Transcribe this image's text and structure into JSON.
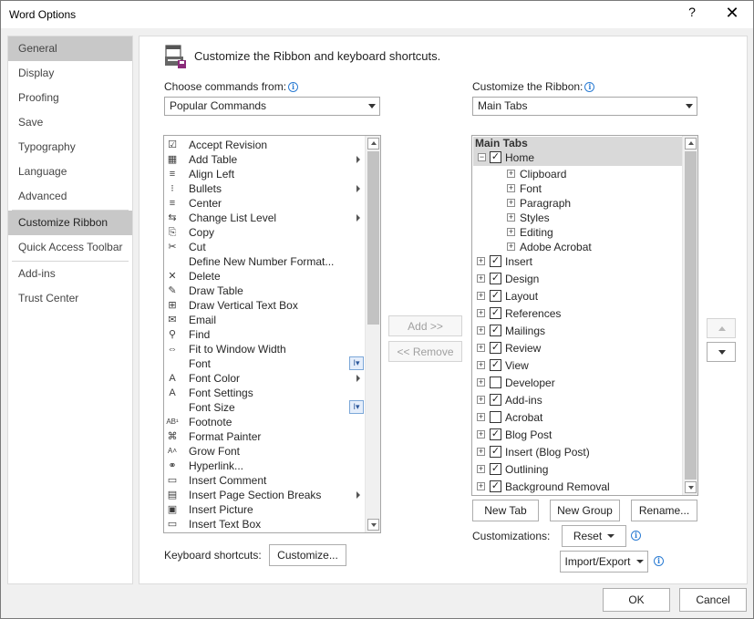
{
  "window": {
    "title": "Word Options",
    "help_glyph": "?",
    "close_glyph": "✕"
  },
  "nav": {
    "items": [
      {
        "label": "General",
        "active": false
      },
      {
        "label": "Display"
      },
      {
        "label": "Proofing"
      },
      {
        "label": "Save"
      },
      {
        "label": "Typography"
      },
      {
        "label": "Language"
      },
      {
        "label": "Advanced"
      },
      {
        "label": "Customize Ribbon"
      },
      {
        "label": "Quick Access Toolbar"
      },
      {
        "label": "Add-ins"
      },
      {
        "label": "Trust Center"
      }
    ]
  },
  "header": {
    "text": "Customize the Ribbon and keyboard shortcuts."
  },
  "left": {
    "choose_label": "Choose commands from:",
    "choose_value": "Popular Commands",
    "commands": [
      {
        "label": "Accept Revision",
        "icon": "☑"
      },
      {
        "label": "Add Table",
        "icon": "▦",
        "submenu": true
      },
      {
        "label": "Align Left",
        "icon": "≡"
      },
      {
        "label": "Bullets",
        "icon": "⁝",
        "submenu": true,
        "bar": true
      },
      {
        "label": "Center",
        "icon": "≡"
      },
      {
        "label": "Change List Level",
        "icon": "⇆",
        "submenu": true
      },
      {
        "label": "Copy",
        "icon": "⎘"
      },
      {
        "label": "Cut",
        "icon": "✂"
      },
      {
        "label": "Define New Number Format...",
        "icon": ""
      },
      {
        "label": "Delete",
        "icon": "✕"
      },
      {
        "label": "Draw Table",
        "icon": "✎"
      },
      {
        "label": "Draw Vertical Text Box",
        "icon": "⊞"
      },
      {
        "label": "Email",
        "icon": "✉"
      },
      {
        "label": "Find",
        "icon": "⚲"
      },
      {
        "label": "Fit to Window Width",
        "icon": "⇔"
      },
      {
        "label": "Font",
        "icon": "",
        "box": "I▾"
      },
      {
        "label": "Font Color",
        "icon": "A",
        "submenu": true
      },
      {
        "label": "Font Settings",
        "icon": "A"
      },
      {
        "label": "Font Size",
        "icon": "",
        "box": "I▾"
      },
      {
        "label": "Footnote",
        "icon": "AB¹"
      },
      {
        "label": "Format Painter",
        "icon": "⌘"
      },
      {
        "label": "Grow Font",
        "icon": "A˄"
      },
      {
        "label": "Hyperlink...",
        "icon": "⚭"
      },
      {
        "label": "Insert Comment",
        "icon": "▭"
      },
      {
        "label": "Insert Page  Section Breaks",
        "icon": "▤",
        "submenu": true
      },
      {
        "label": "Insert Picture",
        "icon": "▣"
      },
      {
        "label": "Insert Text Box",
        "icon": "▭"
      }
    ],
    "keyboard_label": "Keyboard shortcuts:",
    "customize_button": "Customize..."
  },
  "middle": {
    "add_button": "Add >>",
    "remove_button": "<< Remove"
  },
  "right": {
    "customize_label": "Customize the Ribbon:",
    "ribbon_value": "Main Tabs",
    "tree_header": "Main Tabs",
    "home": {
      "label": "Home",
      "checked": true,
      "expander": "−"
    },
    "home_groups": [
      "Clipboard",
      "Font",
      "Paragraph",
      "Styles",
      "Editing",
      "Adobe Acrobat"
    ],
    "tabs": [
      {
        "label": "Insert",
        "checked": true
      },
      {
        "label": "Design",
        "checked": true
      },
      {
        "label": "Layout",
        "checked": true
      },
      {
        "label": "References",
        "checked": true
      },
      {
        "label": "Mailings",
        "checked": true
      },
      {
        "label": "Review",
        "checked": true
      },
      {
        "label": "View",
        "checked": true
      },
      {
        "label": "Developer",
        "checked": false
      },
      {
        "label": "Add-ins",
        "checked": true
      },
      {
        "label": "Acrobat",
        "checked": false
      },
      {
        "label": "Blog Post",
        "checked": true
      },
      {
        "label": "Insert (Blog Post)",
        "checked": true
      },
      {
        "label": "Outlining",
        "checked": true
      },
      {
        "label": "Background Removal",
        "checked": true
      }
    ],
    "new_tab_button": "New Tab",
    "new_group_button": "New Group",
    "rename_button": "Rename...",
    "customizations_label": "Customizations:",
    "reset_button": "Reset",
    "import_export_button": "Import/Export"
  },
  "footer": {
    "ok_button": "OK",
    "cancel_button": "Cancel"
  },
  "colors": {
    "accent": "#2b7cd3",
    "active_nav": "#c8c8c8"
  },
  "icons": {
    "header": "ribbon-customize-icon",
    "info": "info-icon"
  }
}
